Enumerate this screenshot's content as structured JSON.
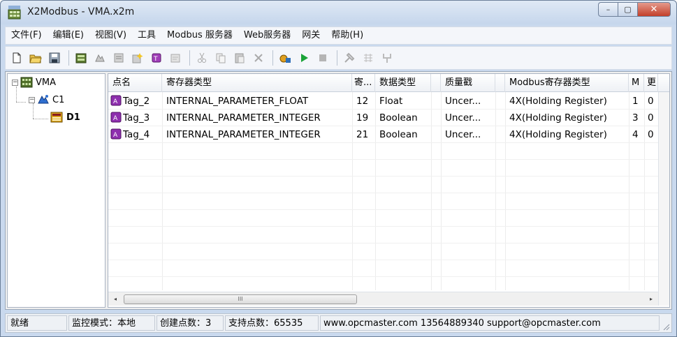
{
  "window": {
    "title": "X2Modbus - VMA.x2m",
    "close_label": "✕",
    "min_label": "–",
    "max_label": "▢"
  },
  "menu": [
    "文件(F)",
    "编辑(E)",
    "视图(V)",
    "工具",
    "Modbus 服务器",
    "Web服务器",
    "网关",
    "帮助(H)"
  ],
  "toolbar_icons": [
    "new-icon",
    "open-icon",
    "save-icon",
    "device-icon",
    "channel-icon",
    "tag-icon",
    "new-tag-icon",
    "tag-group-icon",
    "properties-icon",
    "cut-icon",
    "copy-icon",
    "paste-icon",
    "delete-icon",
    "monitor-icon",
    "start-icon",
    "stop-icon",
    "tools-icon",
    "tool2-icon",
    "tool3-icon"
  ],
  "tree": {
    "root": "VMA",
    "channel": "C1",
    "device": "D1"
  },
  "table": {
    "headers": [
      "点名",
      "寄存器类型",
      "寄...",
      "数据类型",
      "",
      "质量戳",
      "",
      "Modbus寄存器类型",
      "M",
      "更"
    ],
    "rows": [
      [
        "Tag_2",
        "INTERNAL_PARAMETER_FLOAT",
        "12",
        "Float",
        "Uncer...",
        "4X(Holding Register)",
        "1",
        "0"
      ],
      [
        "Tag_3",
        "INTERNAL_PARAMETER_INTEGER",
        "19",
        "Boolean",
        "Uncer...",
        "4X(Holding Register)",
        "3",
        "0"
      ],
      [
        "Tag_4",
        "INTERNAL_PARAMETER_INTEGER",
        "21",
        "Boolean",
        "Uncer...",
        "4X(Holding Register)",
        "4",
        "0"
      ]
    ]
  },
  "scroll": {
    "left": "◂",
    "right": "▸",
    "grip": "III"
  },
  "status": {
    "ready": "就绪",
    "mode": "监控模式：本地",
    "created": "创建点数：3",
    "supported": "支持点数：65535",
    "contact": "www.opcmaster.com 13564889340 support@opcmaster.com"
  }
}
